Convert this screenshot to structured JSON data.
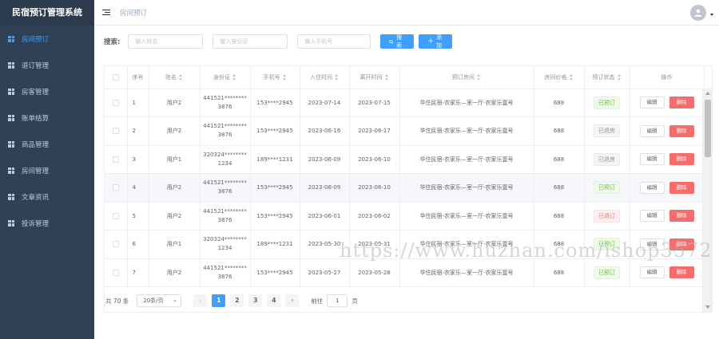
{
  "app": {
    "title": "民宿预订管理系统"
  },
  "sidebar": {
    "items": [
      {
        "label": "房间预订",
        "active": true
      },
      {
        "label": "退订管理",
        "active": false
      },
      {
        "label": "房客管理",
        "active": false
      },
      {
        "label": "账单结算",
        "active": false
      },
      {
        "label": "商品管理",
        "active": false
      },
      {
        "label": "房间管理",
        "active": false
      },
      {
        "label": "文章资讯",
        "active": false
      },
      {
        "label": "投诉管理",
        "active": false
      }
    ]
  },
  "header": {
    "breadcrumb": "房间预订"
  },
  "search": {
    "label": "搜索:",
    "name_placeholder": "输入姓名",
    "idcard_placeholder": "输入身份证",
    "phone_placeholder": "输入手机号",
    "search_label": "搜索",
    "add_label": "添加"
  },
  "table": {
    "headers": {
      "index": "序号",
      "name": "姓名",
      "idcard": "身份证",
      "phone": "手机号",
      "checkin": "入住时间",
      "checkout": "离开时间",
      "room": "预订房间",
      "price": "房间价格",
      "status": "预订状态",
      "actions": "操作"
    },
    "edit_label": "编辑",
    "delete_label": "删除",
    "rows": [
      {
        "index": "1",
        "name": "用户2",
        "idcard": "441521********3876",
        "phone": "153****2945",
        "checkin": "2023-07-14",
        "checkout": "2023-07-15",
        "room": "华住民宿-农家乐—室一厅-农家乐壹号",
        "price": "688",
        "status": "已预订",
        "status_type": "success"
      },
      {
        "index": "2",
        "name": "用户2",
        "idcard": "441521********3876",
        "phone": "153****2945",
        "checkin": "2023-06-16",
        "checkout": "2023-06-17",
        "room": "华住民宿-农家乐—室一厅-农家乐壹号",
        "price": "688",
        "status": "已退房",
        "status_type": "info"
      },
      {
        "index": "3",
        "name": "用户1",
        "idcard": "320324********1234",
        "phone": "189****1231",
        "checkin": "2023-06-09",
        "checkout": "2023-06-10",
        "room": "华住民宿-农家乐—室一厅-农家乐壹号",
        "price": "688",
        "status": "已退房",
        "status_type": "info"
      },
      {
        "index": "4",
        "name": "用户2",
        "idcard": "441521********3876",
        "phone": "153****2945",
        "checkin": "2023-06-09",
        "checkout": "2023-06-10",
        "room": "华住民宿-农家乐—室一厅-农家乐壹号",
        "price": "688",
        "status": "已预订",
        "status_type": "success"
      },
      {
        "index": "5",
        "name": "用户2",
        "idcard": "441521********3876",
        "phone": "153****2945",
        "checkin": "2023-06-01",
        "checkout": "2023-06-02",
        "room": "华住民宿-农家乐—室一厅-农家乐壹号",
        "price": "688",
        "status": "已退订",
        "status_type": "danger"
      },
      {
        "index": "6",
        "name": "用户1",
        "idcard": "320324********1234",
        "phone": "189****1231",
        "checkin": "2023-05-30",
        "checkout": "2023-05-31",
        "room": "华住民宿-农家乐—室一厅-农家乐壹号",
        "price": "688",
        "status": "已预订",
        "status_type": "success"
      },
      {
        "index": "7",
        "name": "用户2",
        "idcard": "441521********3876",
        "phone": "153****2945",
        "checkin": "2023-05-27",
        "checkout": "2023-05-28",
        "room": "华住民宿-农家乐—室一厅-农家乐壹号",
        "price": "688",
        "status": "已预订",
        "status_type": "success"
      }
    ]
  },
  "pagination": {
    "total": "共 70 条",
    "page_size": "20条/页",
    "pages": [
      "1",
      "2",
      "3",
      "4"
    ],
    "current": "1",
    "goto_prefix": "前往",
    "goto_value": "1",
    "goto_suffix": "页"
  },
  "watermark": {
    "text": "https://www.huzhan.com/ishop3572"
  },
  "colors": {
    "sidebar_bg": "#304156",
    "primary": "#409eff",
    "success": "#67c23a",
    "danger": "#f56c6c",
    "info": "#909399"
  }
}
